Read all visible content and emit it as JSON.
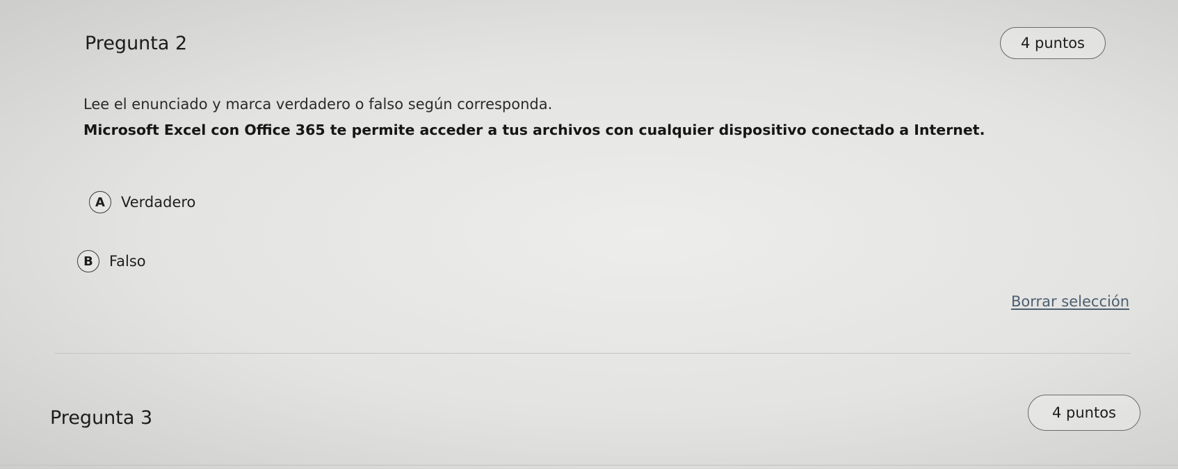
{
  "question2": {
    "title": "Pregunta 2",
    "points": "4 puntos",
    "instruction": "Lee el enunciado y marca verdadero o falso según corresponda.",
    "statement": "Microsoft Excel con Office 365 te permite acceder a tus archivos con cualquier dispositivo conectado a Internet.",
    "options": [
      {
        "letter": "A",
        "label": "Verdadero"
      },
      {
        "letter": "B",
        "label": "Falso"
      }
    ],
    "clear_selection": "Borrar selección"
  },
  "question3": {
    "title": "Pregunta 3",
    "points": "4 puntos"
  },
  "colors": {
    "link": "#4d5e70",
    "text": "#1f1f1f",
    "border": "#6a6a6a"
  }
}
